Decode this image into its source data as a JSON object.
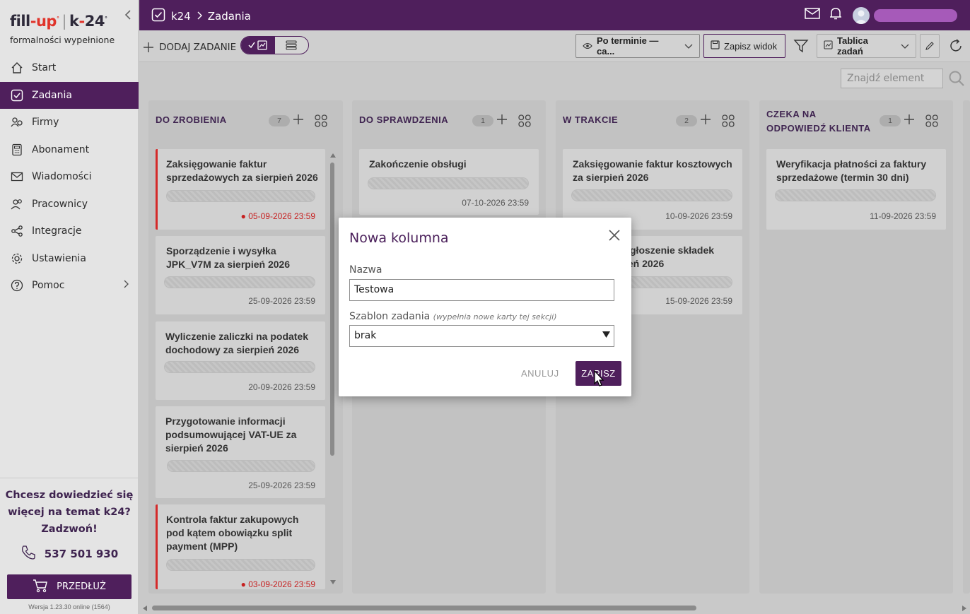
{
  "brand": {
    "fill": "fill",
    "dash": "-",
    "up": "up",
    "sep": "|",
    "k": "k",
    "k_dash": "-",
    "k_num": "24",
    "tagline": "formalności wypełnione"
  },
  "sidebar": {
    "items": [
      {
        "label": "Start",
        "icon": "home-icon"
      },
      {
        "label": "Zadania",
        "icon": "checkbox-icon",
        "active": true
      },
      {
        "label": "Firmy",
        "icon": "companies-icon"
      },
      {
        "label": "Abonament",
        "icon": "calculator-icon"
      },
      {
        "label": "Wiadomości",
        "icon": "mail-icon"
      },
      {
        "label": "Pracownicy",
        "icon": "users-icon"
      },
      {
        "label": "Integracje",
        "icon": "share-icon"
      },
      {
        "label": "Ustawienia",
        "icon": "gear-icon"
      },
      {
        "label": "Pomoc",
        "icon": "help-icon"
      }
    ],
    "promo_line1": "Chcesz dowiedzieć się",
    "promo_line2": "więcej na temat k24?",
    "promo_line3": "Zadzwoń!",
    "phone": "537 501 930",
    "extend_label": "PRZEDŁUŻ",
    "version": "Wersja 1.23.30 online (1564)"
  },
  "topbar": {
    "crumb_root": "k24",
    "crumb_current": "Zadania"
  },
  "toolbar": {
    "add_task": "DODAJ ZADANIE",
    "sort_label": "Po terminie — ca...",
    "save_view": "Zapisz widok",
    "board_label": "Tablica zadań"
  },
  "search": {
    "placeholder": "Znajdź element"
  },
  "columns": [
    {
      "title_line1": "DO ZROBIENIA",
      "title_line2": "",
      "count": "7",
      "cards": [
        {
          "title": "Zaksięgowanie faktur sprzedażowych za sierpień 2026",
          "date": "05-09-2026 23:59",
          "urgent": true
        },
        {
          "title": "Sporządzenie i wysyłka JPK_V7M za sierpień 2026",
          "date": "25-09-2026 23:59"
        },
        {
          "title": "Wyliczenie zaliczki na podatek dochodowy za sierpień 2026",
          "date": "20-09-2026 23:59"
        },
        {
          "title": "Przygotowanie informacji podsumowującej VAT-UE za sierpień 2026",
          "date": "25-09-2026 23:59"
        },
        {
          "title": "Kontrola faktur zakupowych pod kątem obowiązku split payment (MPP)",
          "date": "03-09-2026 23:59",
          "urgent": true
        }
      ]
    },
    {
      "title_line1": "DO SPRAWDZENIA",
      "title_line2": "",
      "count": "1",
      "cards": [
        {
          "title": "Zakończenie obsługi",
          "date": "07-10-2026 23:59"
        }
      ]
    },
    {
      "title_line1": "W TRAKCIE",
      "title_line2": "",
      "count": "2",
      "cards": [
        {
          "title": "Zaksięgowanie faktur kosztowych za sierpień 2026",
          "date": "10-09-2026 23:59"
        },
        {
          "title_visible": "zgłoszenie składek",
          "title_visible2": "ień 2026",
          "date": "15-09-2026 23:59"
        }
      ]
    },
    {
      "title_line1": "CZEKA NA",
      "title_line2": "ODPOWIEDŹ KLIENTA",
      "count": "1",
      "cards": [
        {
          "title": "Weryfikacja płatności za faktury sprzedażowe (termin 30 dni)",
          "date": "11-09-2026 23:59"
        }
      ]
    }
  ],
  "modal": {
    "title": "Nowa kolumna",
    "name_label": "Nazwa",
    "name_value": "Testowa",
    "template_label": "Szablon zadania",
    "template_hint": "(wypełnia nowe karty tej sekcji)",
    "template_value": "brak",
    "cancel": "ANULUJ",
    "save": "ZAPISZ"
  },
  "colors": {
    "accent": "#4f1f5c",
    "urgent": "#d42a2a"
  }
}
